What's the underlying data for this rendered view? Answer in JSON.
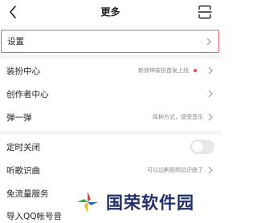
{
  "nav": {
    "title": "更多"
  },
  "settings": {
    "label": "设置"
  },
  "items": [
    {
      "label": "装扮中心",
      "sub": "新徐坤装扮首发上线"
    },
    {
      "label": "创作者中心",
      "sub": ""
    },
    {
      "label": "弹一弹",
      "sub": "挥种方式，感受音乐"
    },
    {
      "label": "定时关闭",
      "sub": ""
    },
    {
      "label": "听歌识曲",
      "sub": "可以边刷视频边识曲了"
    },
    {
      "label": "免流量服务",
      "sub": ""
    },
    {
      "label": "导入QQ帐号音",
      "sub": ""
    }
  ],
  "watermark": {
    "text": "国荣软件园"
  },
  "colors": {
    "highlight_border": "#e85b6b",
    "red_dot": "#e8403a",
    "watermark": "#1e2f6b"
  },
  "toggle": {
    "state": "off"
  }
}
